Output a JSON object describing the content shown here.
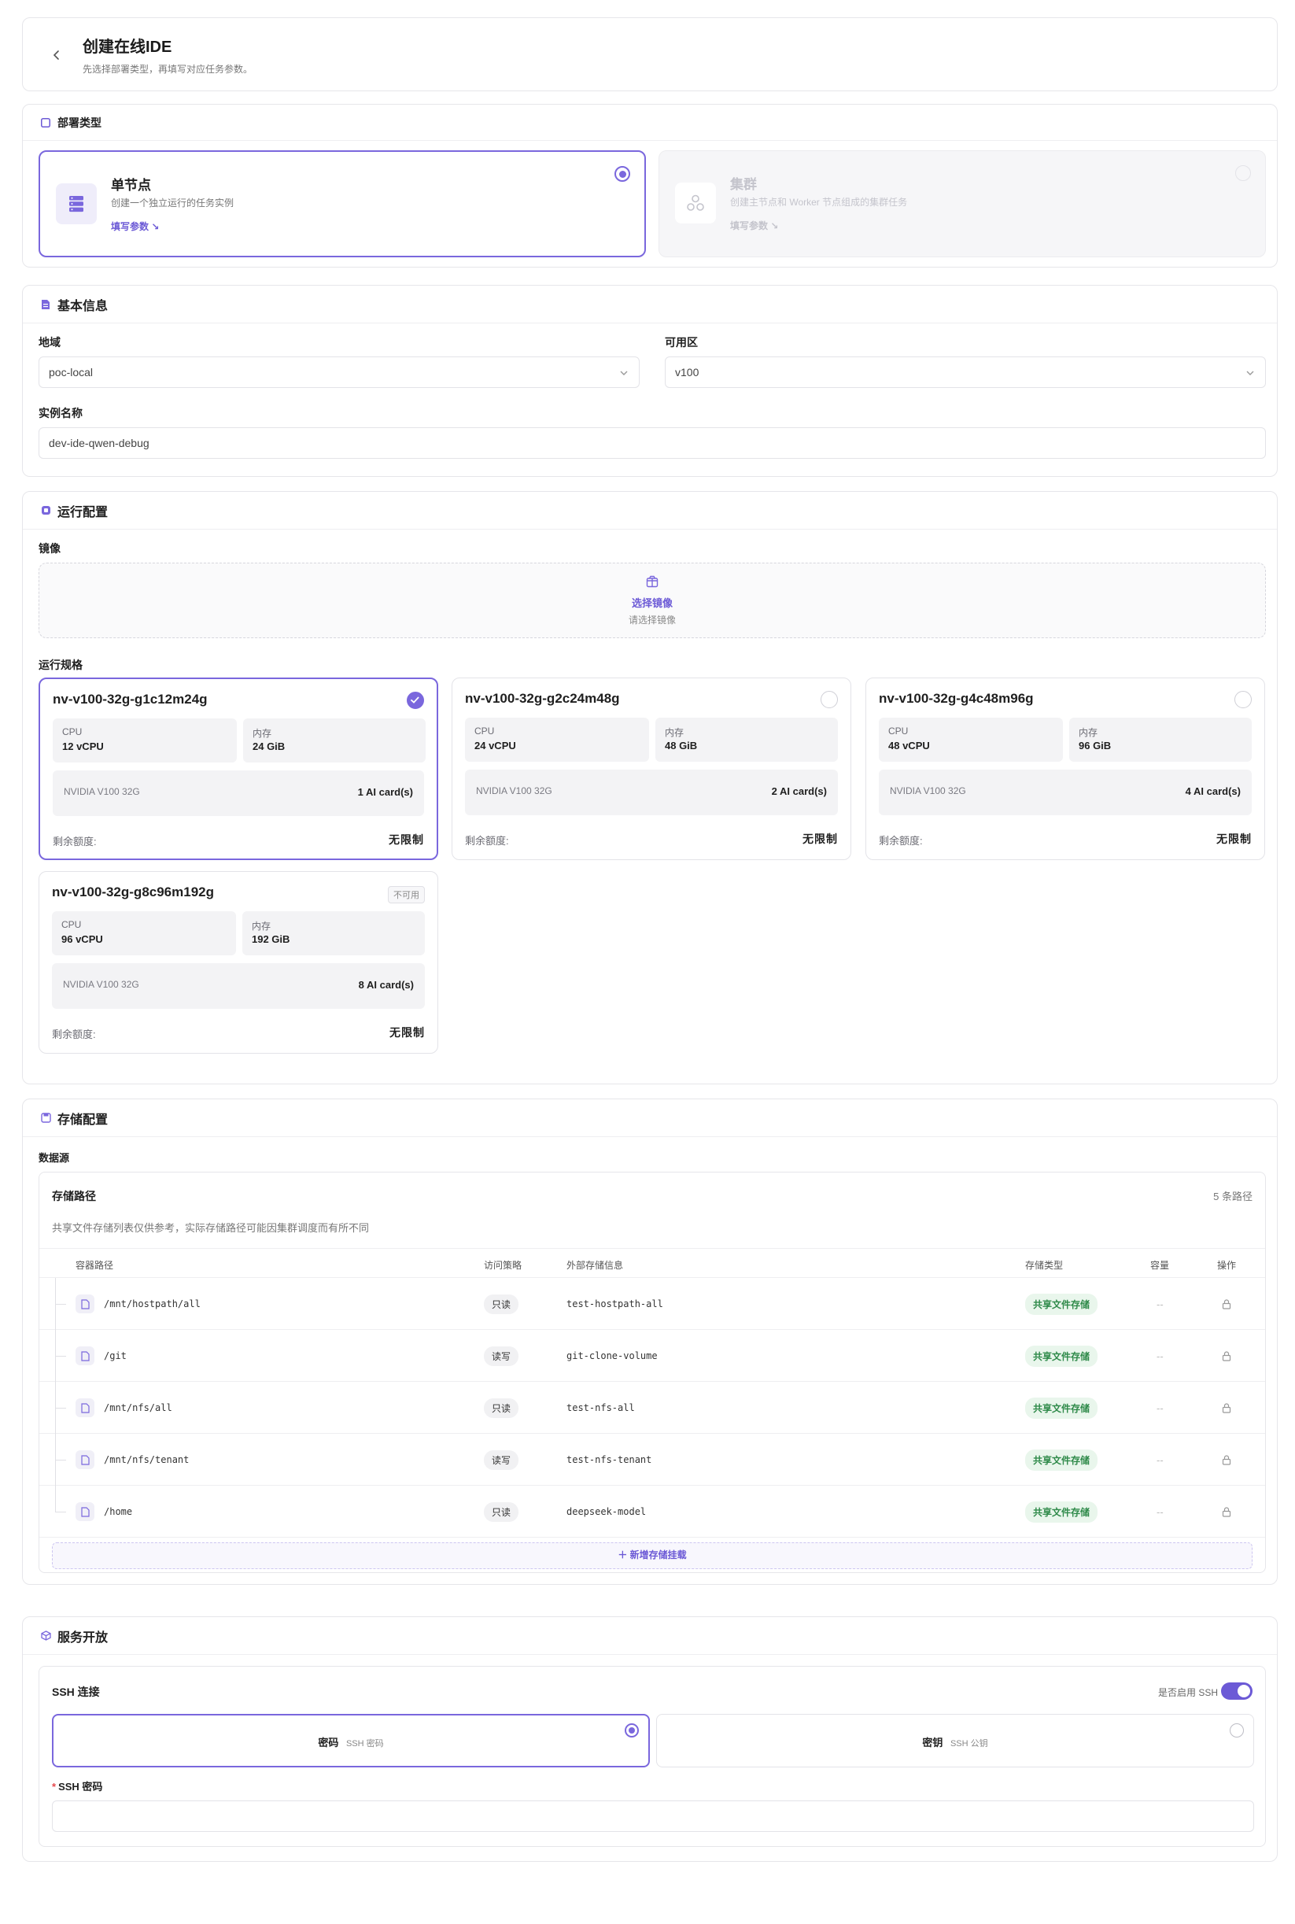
{
  "header": {
    "title": "创建在线IDE",
    "subtitle": "先选择部署类型，再填写对应任务参数。"
  },
  "deploy": {
    "section_title": "部署类型",
    "options": [
      {
        "title": "单节点",
        "desc": "创建一个独立运行的任务实例",
        "link": "填写参数 ↘",
        "selected": true
      },
      {
        "title": "集群",
        "desc": "创建主节点和 Worker 节点组成的集群任务",
        "link": "填写参数 ↘",
        "selected": false
      }
    ]
  },
  "basic": {
    "section_title": "基本信息",
    "region_label": "地域",
    "region_value": "poc-local",
    "zone_label": "可用区",
    "zone_value": "v100",
    "name_label": "实例名称",
    "name_value": "dev-ide-qwen-debug"
  },
  "runtime": {
    "section_title": "运行配置",
    "image_label": "镜像",
    "image_button": "选择镜像",
    "image_placeholder": "请选择镜像",
    "spec_label": "运行规格",
    "specs": [
      {
        "name": "nv-v100-32g-g1c12m24g",
        "cpu_label": "CPU",
        "cpu": "12 vCPU",
        "mem_label": "内存",
        "mem": "24 GiB",
        "gpu": "NVIDIA V100 32G",
        "cards": "1 AI card(s)",
        "quota_label": "剩余额度:",
        "quota": "无限制",
        "state": "selected"
      },
      {
        "name": "nv-v100-32g-g2c24m48g",
        "cpu_label": "CPU",
        "cpu": "24 vCPU",
        "mem_label": "内存",
        "mem": "48 GiB",
        "gpu": "NVIDIA V100 32G",
        "cards": "2 AI card(s)",
        "quota_label": "剩余额度:",
        "quota": "无限制",
        "state": "available"
      },
      {
        "name": "nv-v100-32g-g4c48m96g",
        "cpu_label": "CPU",
        "cpu": "48 vCPU",
        "mem_label": "内存",
        "mem": "96 GiB",
        "gpu": "NVIDIA V100 32G",
        "cards": "4 AI card(s)",
        "quota_label": "剩余额度:",
        "quota": "无限制",
        "state": "available"
      },
      {
        "name": "nv-v100-32g-g8c96m192g",
        "cpu_label": "CPU",
        "cpu": "96 vCPU",
        "mem_label": "内存",
        "mem": "192 GiB",
        "gpu": "NVIDIA V100 32G",
        "cards": "8 AI card(s)",
        "quota_label": "剩余额度:",
        "quota": "无限制",
        "state": "unavailable",
        "badge": "不可用"
      }
    ]
  },
  "storage": {
    "section_title": "存储配置",
    "source_label": "数据源",
    "panel_title": "存储路径",
    "count": "5 条路径",
    "note": "共享文件存储列表仅供参考，实际存储路径可能因集群调度而有所不同",
    "columns": [
      "容器路径",
      "访问策略",
      "外部存储信息",
      "存储类型",
      "容量",
      "操作"
    ],
    "rows": [
      {
        "path": "/mnt/hostpath/all",
        "access": "只读",
        "external": "test-hostpath-all",
        "type": "共享文件存储",
        "capacity": "--"
      },
      {
        "path": "/git",
        "access": "读写",
        "external": "git-clone-volume",
        "type": "共享文件存储",
        "capacity": "--"
      },
      {
        "path": "/mnt/nfs/all",
        "access": "只读",
        "external": "test-nfs-all",
        "type": "共享文件存储",
        "capacity": "--"
      },
      {
        "path": "/mnt/nfs/tenant",
        "access": "读写",
        "external": "test-nfs-tenant",
        "type": "共享文件存储",
        "capacity": "--"
      },
      {
        "path": "/home",
        "access": "只读",
        "external": "deepseek-model",
        "type": "共享文件存储",
        "capacity": "--"
      }
    ],
    "add_button": "＋ 新增存储挂载"
  },
  "service": {
    "section_title": "服务开放",
    "ssh_title": "SSH 连接",
    "ssh_toggle_label": "是否启用 SSH",
    "ssh_enabled": true,
    "auth_options": [
      {
        "title": "密码",
        "sub": "SSH 密码",
        "selected": true
      },
      {
        "title": "密钥",
        "sub": "SSH 公钥",
        "selected": false
      }
    ],
    "password_label": "SSH 密码",
    "required_mark": "*",
    "password_value": ""
  },
  "colors": {
    "accent": "#7a67dd",
    "border": "#e3e3e8",
    "green": "#2f8a4a"
  }
}
